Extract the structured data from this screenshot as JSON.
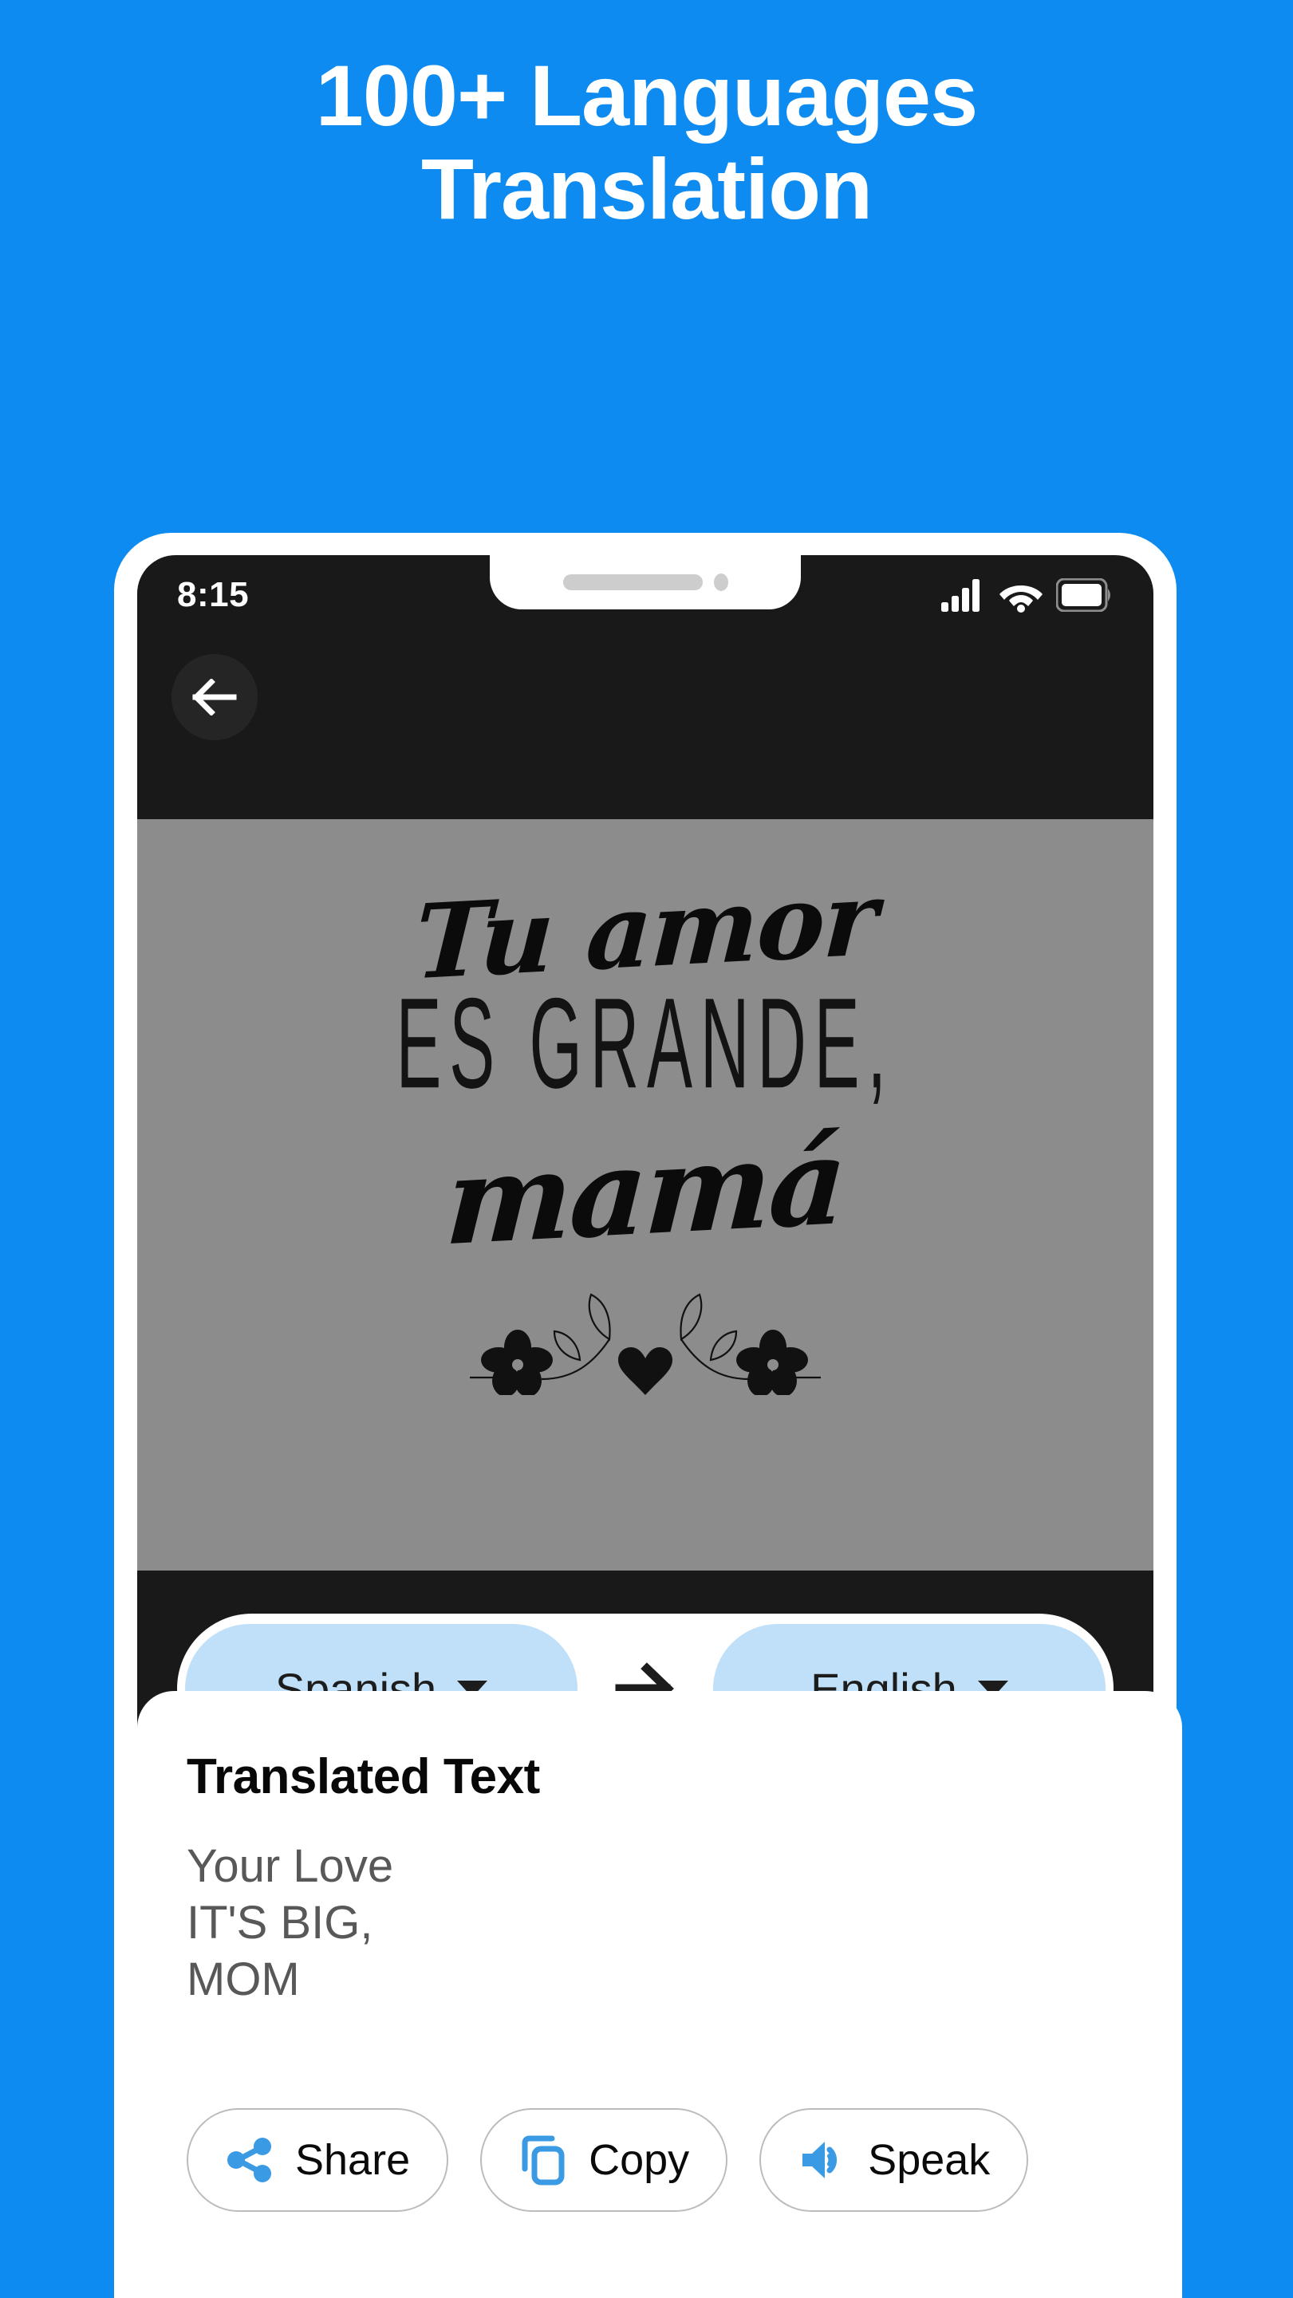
{
  "theme": {
    "background_blue": "#0d8bf0",
    "pill_blue": "#bfe0f8",
    "icon_blue": "#3a9ae4",
    "screen_black": "#191919",
    "image_gray": "#8c8c8c",
    "body_text_gray": "#585858"
  },
  "headline": {
    "line1": "100+ Languages",
    "line2": "Translation"
  },
  "status_bar": {
    "time": "8:15",
    "signal_icon": "cellular-signal-icon",
    "wifi_icon": "wifi-icon",
    "battery_icon": "battery-icon"
  },
  "nav": {
    "back_icon": "arrow-left-icon"
  },
  "image_preview": {
    "poster_line1": "Tu amor",
    "poster_line2": "ES GRANDE,",
    "poster_line3": "mamá",
    "decoration": "floral-heart-icon"
  },
  "language_selector": {
    "source_language": "Spanish",
    "target_language": "English",
    "arrow_icon": "arrow-right-icon",
    "source_caret_icon": "chevron-down-icon",
    "target_caret_icon": "chevron-down-icon"
  },
  "result": {
    "title": "Translated Text",
    "text": "Your Love\nIT'S BIG,\nMOM"
  },
  "actions": [
    {
      "label": "Share",
      "icon": "share-icon"
    },
    {
      "label": "Copy",
      "icon": "copy-icon"
    },
    {
      "label": "Speak",
      "icon": "speaker-icon"
    }
  ]
}
